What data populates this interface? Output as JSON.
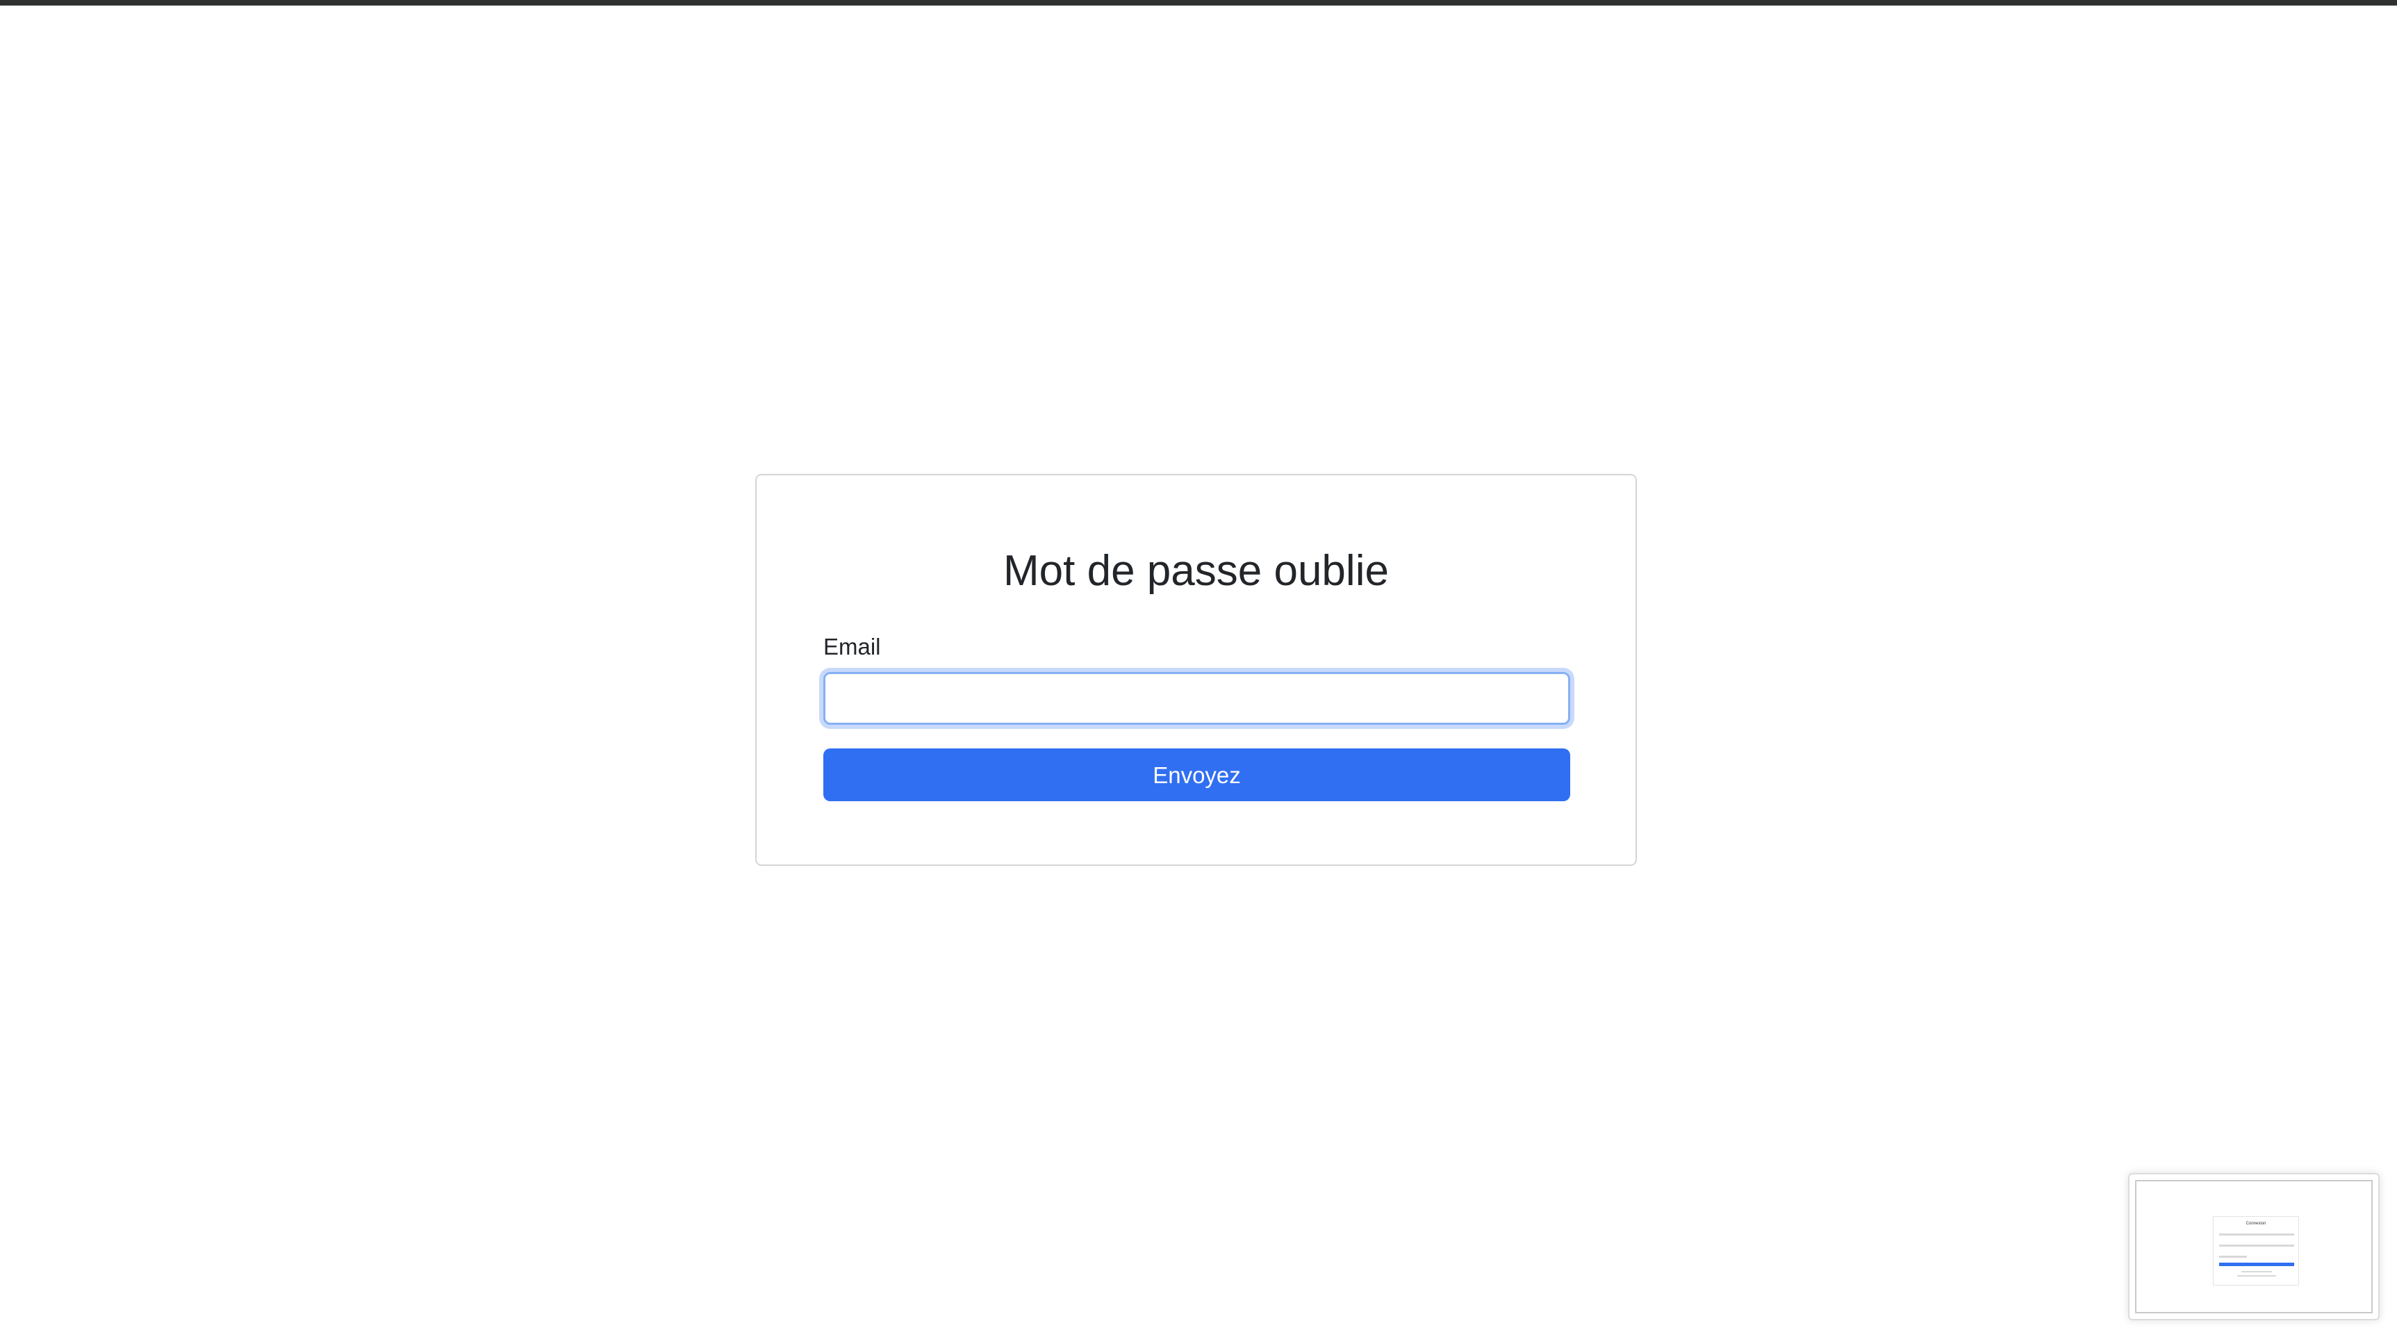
{
  "page": {
    "title": "Mot de passe oublie"
  },
  "form": {
    "email_label": "Email",
    "email_value": "",
    "email_placeholder": "",
    "submit_label": "Envoyez"
  },
  "thumbnail": {
    "title": "Connexion"
  },
  "colors": {
    "accent": "#316ff2",
    "top_bar": "#2f3030",
    "text": "#222529"
  }
}
